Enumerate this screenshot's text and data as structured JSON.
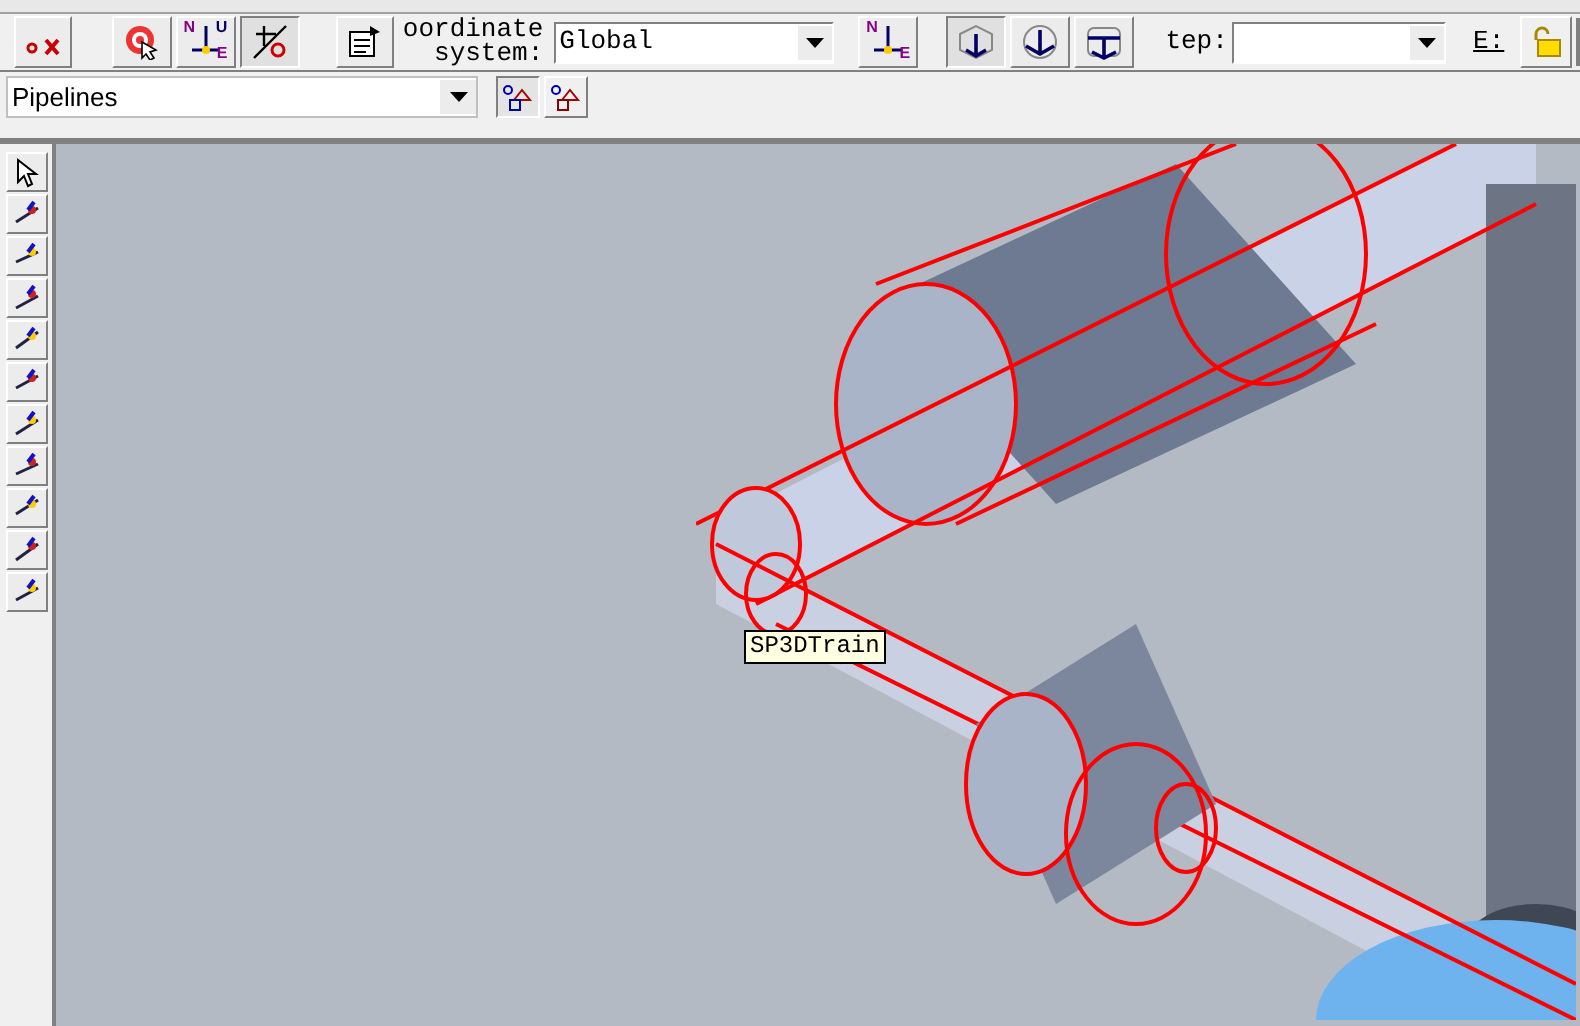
{
  "toolbar_buttons": [
    {
      "kind": "point-delete",
      "pressed": false
    },
    {
      "kind": "target",
      "pressed": false
    },
    {
      "kind": "compass",
      "pressed": false,
      "letters": [
        "N",
        "U",
        "E"
      ]
    },
    {
      "kind": "angle",
      "pressed": true
    },
    {
      "kind": "properties",
      "pressed": false
    }
  ],
  "coordinate_system": {
    "label_line_1": "oordinate",
    "label_line_2": "system:",
    "value": "Global"
  },
  "view_buttons": [
    {
      "kind": "compass",
      "pressed": false,
      "letters": [
        "N",
        "E"
      ]
    },
    {
      "kind": "cube",
      "pressed": true
    },
    {
      "kind": "circle",
      "pressed": false
    },
    {
      "kind": "cylinder",
      "pressed": false
    }
  ],
  "step": {
    "label": "tep:"
  },
  "e_label": "E:",
  "filter": {
    "value": "Pipelines"
  },
  "filter_buttons": [
    {
      "pressed": true
    },
    {
      "pressed": false
    }
  ],
  "tooltip": "SP3DTrain"
}
